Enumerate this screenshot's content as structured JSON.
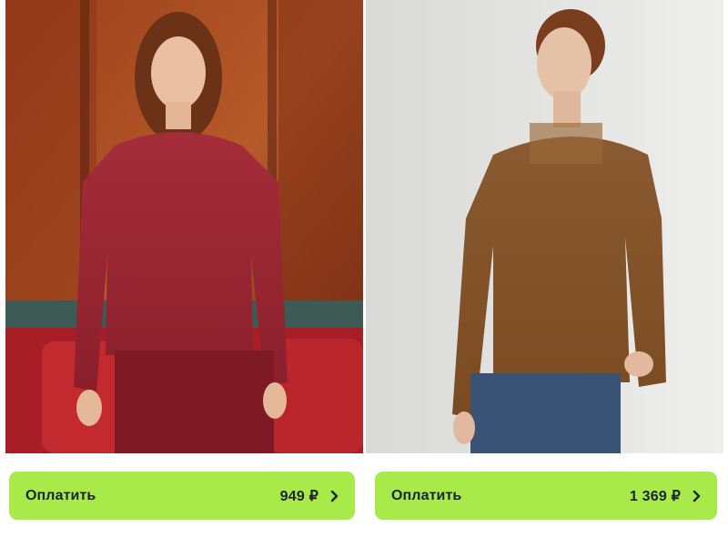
{
  "theme": {
    "button_bg": "#a7ea4a",
    "button_text": "#20232a"
  },
  "products": [
    {
      "image_icon": "model-photo-burgundy-top",
      "button_label": "Оплатить",
      "price": "949 ₽",
      "chevron_icon": "chevron-right-icon"
    },
    {
      "image_icon": "model-photo-brown-top",
      "button_label": "Оплатить",
      "price": "1 369 ₽",
      "chevron_icon": "chevron-right-icon"
    }
  ]
}
